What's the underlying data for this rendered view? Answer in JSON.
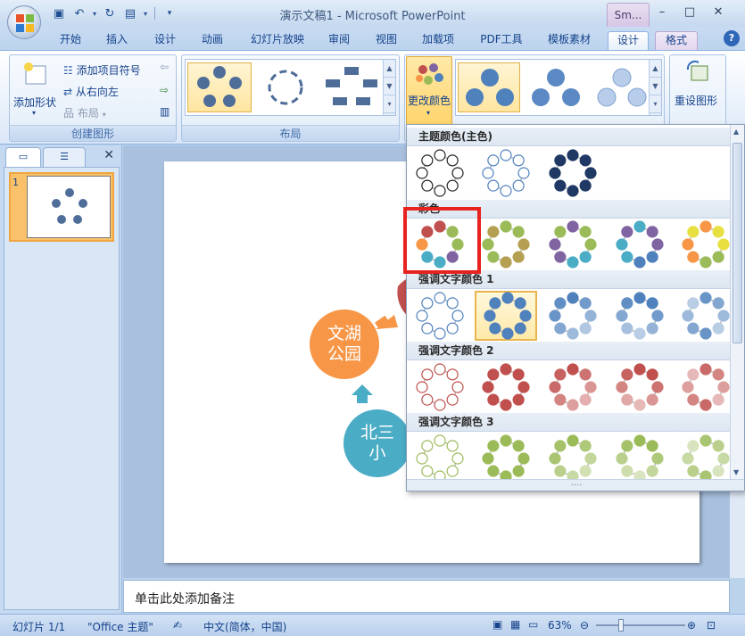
{
  "window": {
    "title": "演示文稿1 - Microsoft PowerPoint",
    "context_tab_title": "Sm...",
    "controls": [
      "–",
      "□",
      "✕"
    ]
  },
  "tabs": [
    "开始",
    "插入",
    "设计",
    "动画",
    "幻灯片放映",
    "审阅",
    "视图",
    "加载项",
    "PDF工具",
    "模板素材",
    "设计",
    "格式"
  ],
  "ribbon": {
    "create_graphic": {
      "label": "创建图形",
      "add_shape": "添加形状",
      "add_bullet": "添加项目符号",
      "right_to_left": "从右向左",
      "layout": "布局"
    },
    "layouts": {
      "label": "布局"
    },
    "change_colors": "更改颜色",
    "reset_graphic": "重设图形"
  },
  "color_dropdown": {
    "sections": [
      {
        "title": "主题颜色(主色)"
      },
      {
        "title": "彩色"
      },
      {
        "title": "强调文字颜色 1"
      },
      {
        "title": "强调文字颜色 2"
      },
      {
        "title": "强调文字颜色 3"
      }
    ],
    "colors": {
      "dark": "#1f3864",
      "accent1": "#4f81bd",
      "accent2": "#c0504d",
      "accent3": "#9bbb59",
      "orange": "#f79646",
      "teal": "#4bacc6",
      "purple": "#8064a2"
    }
  },
  "slide": {
    "nodes": [
      {
        "text": "文湖\n公园",
        "color": "#f79646"
      },
      {
        "text": "北三\n小",
        "color": "#4bacc6"
      }
    ],
    "slide_number": "1"
  },
  "notes_placeholder": "单击此处添加备注",
  "status": {
    "slide_info": "幻灯片 1/1",
    "theme": "\"Office 主题\"",
    "language": "中文(简体，中国)",
    "zoom": "63%"
  }
}
